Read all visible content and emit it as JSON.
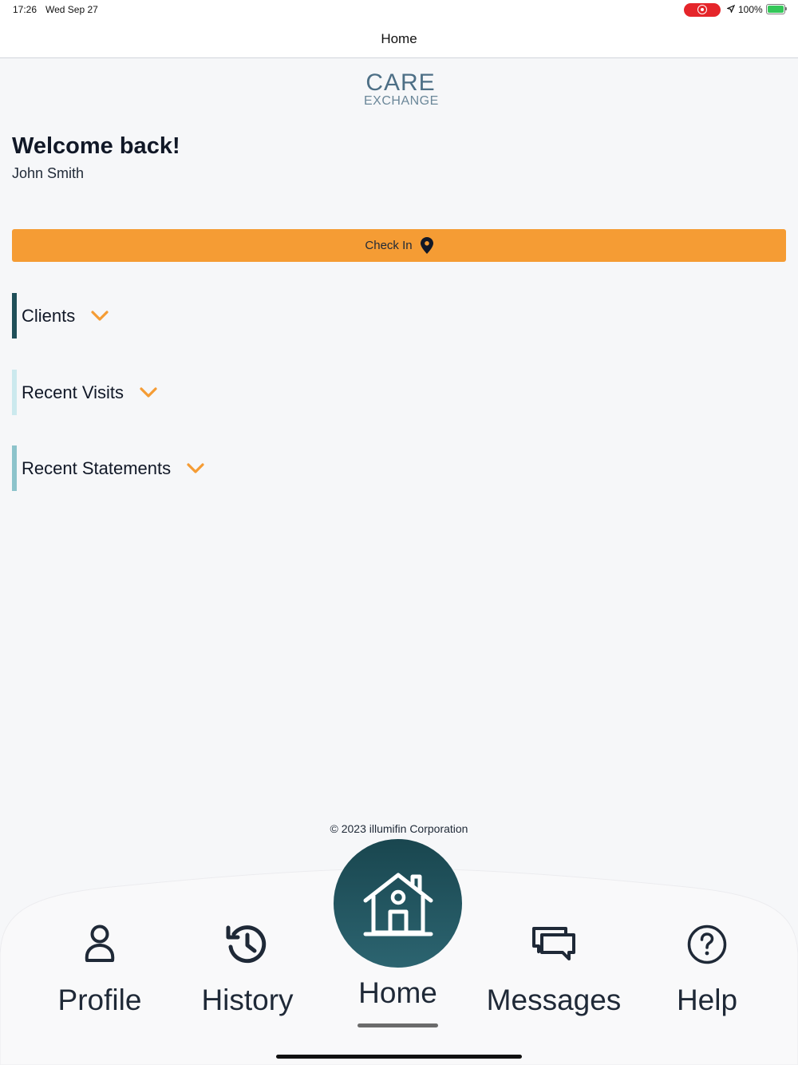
{
  "status_bar": {
    "time": "17:26",
    "date": "Wed Sep 27",
    "battery": "100%"
  },
  "nav": {
    "title": "Home"
  },
  "logo": {
    "line1": "CARE",
    "line2": "EXCHANGE"
  },
  "greeting": {
    "title": "Welcome back!",
    "name": "John Smith"
  },
  "check_in": {
    "label": "Check In"
  },
  "sections": [
    {
      "label": "Clients",
      "bar_color": "#1f4f59"
    },
    {
      "label": "Recent Visits",
      "bar_color": "#cbe9ee"
    },
    {
      "label": "Recent Statements",
      "bar_color": "#8cc3cb"
    }
  ],
  "footer": {
    "copyright": "© 2023 illumifin Corporation"
  },
  "tabs": [
    {
      "label": "Profile",
      "icon": "person-icon"
    },
    {
      "label": "History",
      "icon": "history-icon"
    },
    {
      "label": "Home",
      "icon": "house-icon",
      "active": true
    },
    {
      "label": "Messages",
      "icon": "chat-bubbles-icon"
    },
    {
      "label": "Help",
      "icon": "question-circle-icon"
    }
  ],
  "colors": {
    "accent": "#f59c34",
    "primary": "#1f4f59",
    "background": "#f6f7f9"
  }
}
